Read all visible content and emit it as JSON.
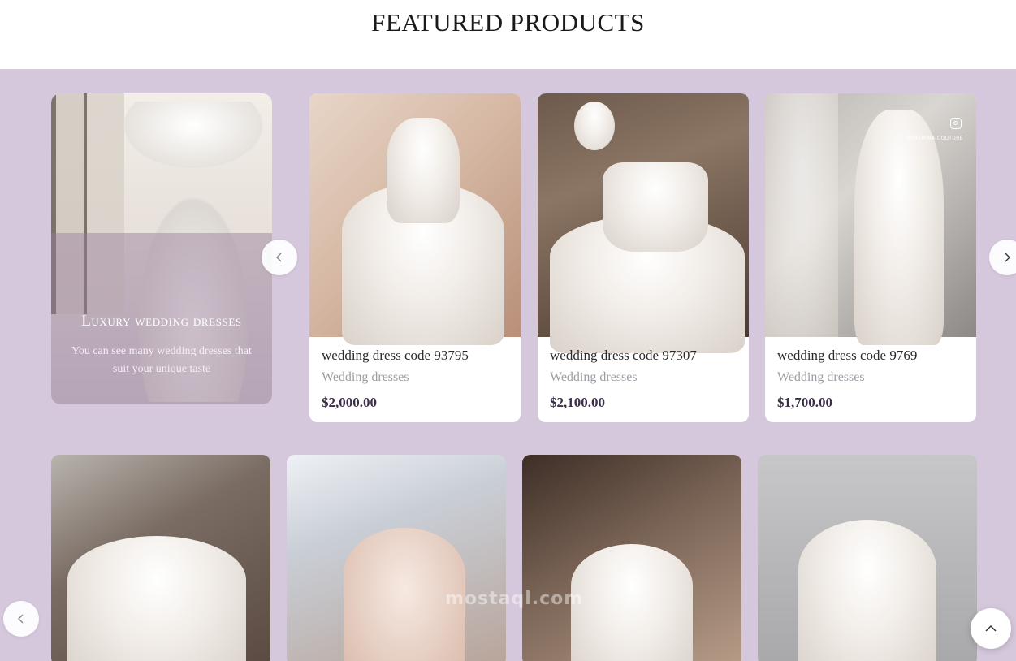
{
  "page": {
    "section_title": "FEATURED PRODUCTS"
  },
  "promo": {
    "title": "Luxury wedding dresses",
    "subtitle": "You can see many wedding dresses that suit your unique taste"
  },
  "products": [
    {
      "name": "wedding dress code 93795",
      "category": "Wedding dresses",
      "price": "$2,000.00"
    },
    {
      "name": "wedding dress code 97307",
      "category": "Wedding dresses",
      "price": "$2,100.00"
    },
    {
      "name": "wedding dress code 9769",
      "category": "Wedding dresses",
      "price": "$1,700.00",
      "image_overlay_tag": "@YASMINA.COUTURE"
    }
  ],
  "watermark": "mostaql.com",
  "icons": {
    "prev": "chevron-left-icon",
    "next": "chevron-right-icon",
    "scroll_top": "chevron-up-icon",
    "instagram": "instagram-icon"
  },
  "colors": {
    "section_bg": "#d6c8dc",
    "price": "#3b2f48",
    "category": "#a09aa3"
  }
}
